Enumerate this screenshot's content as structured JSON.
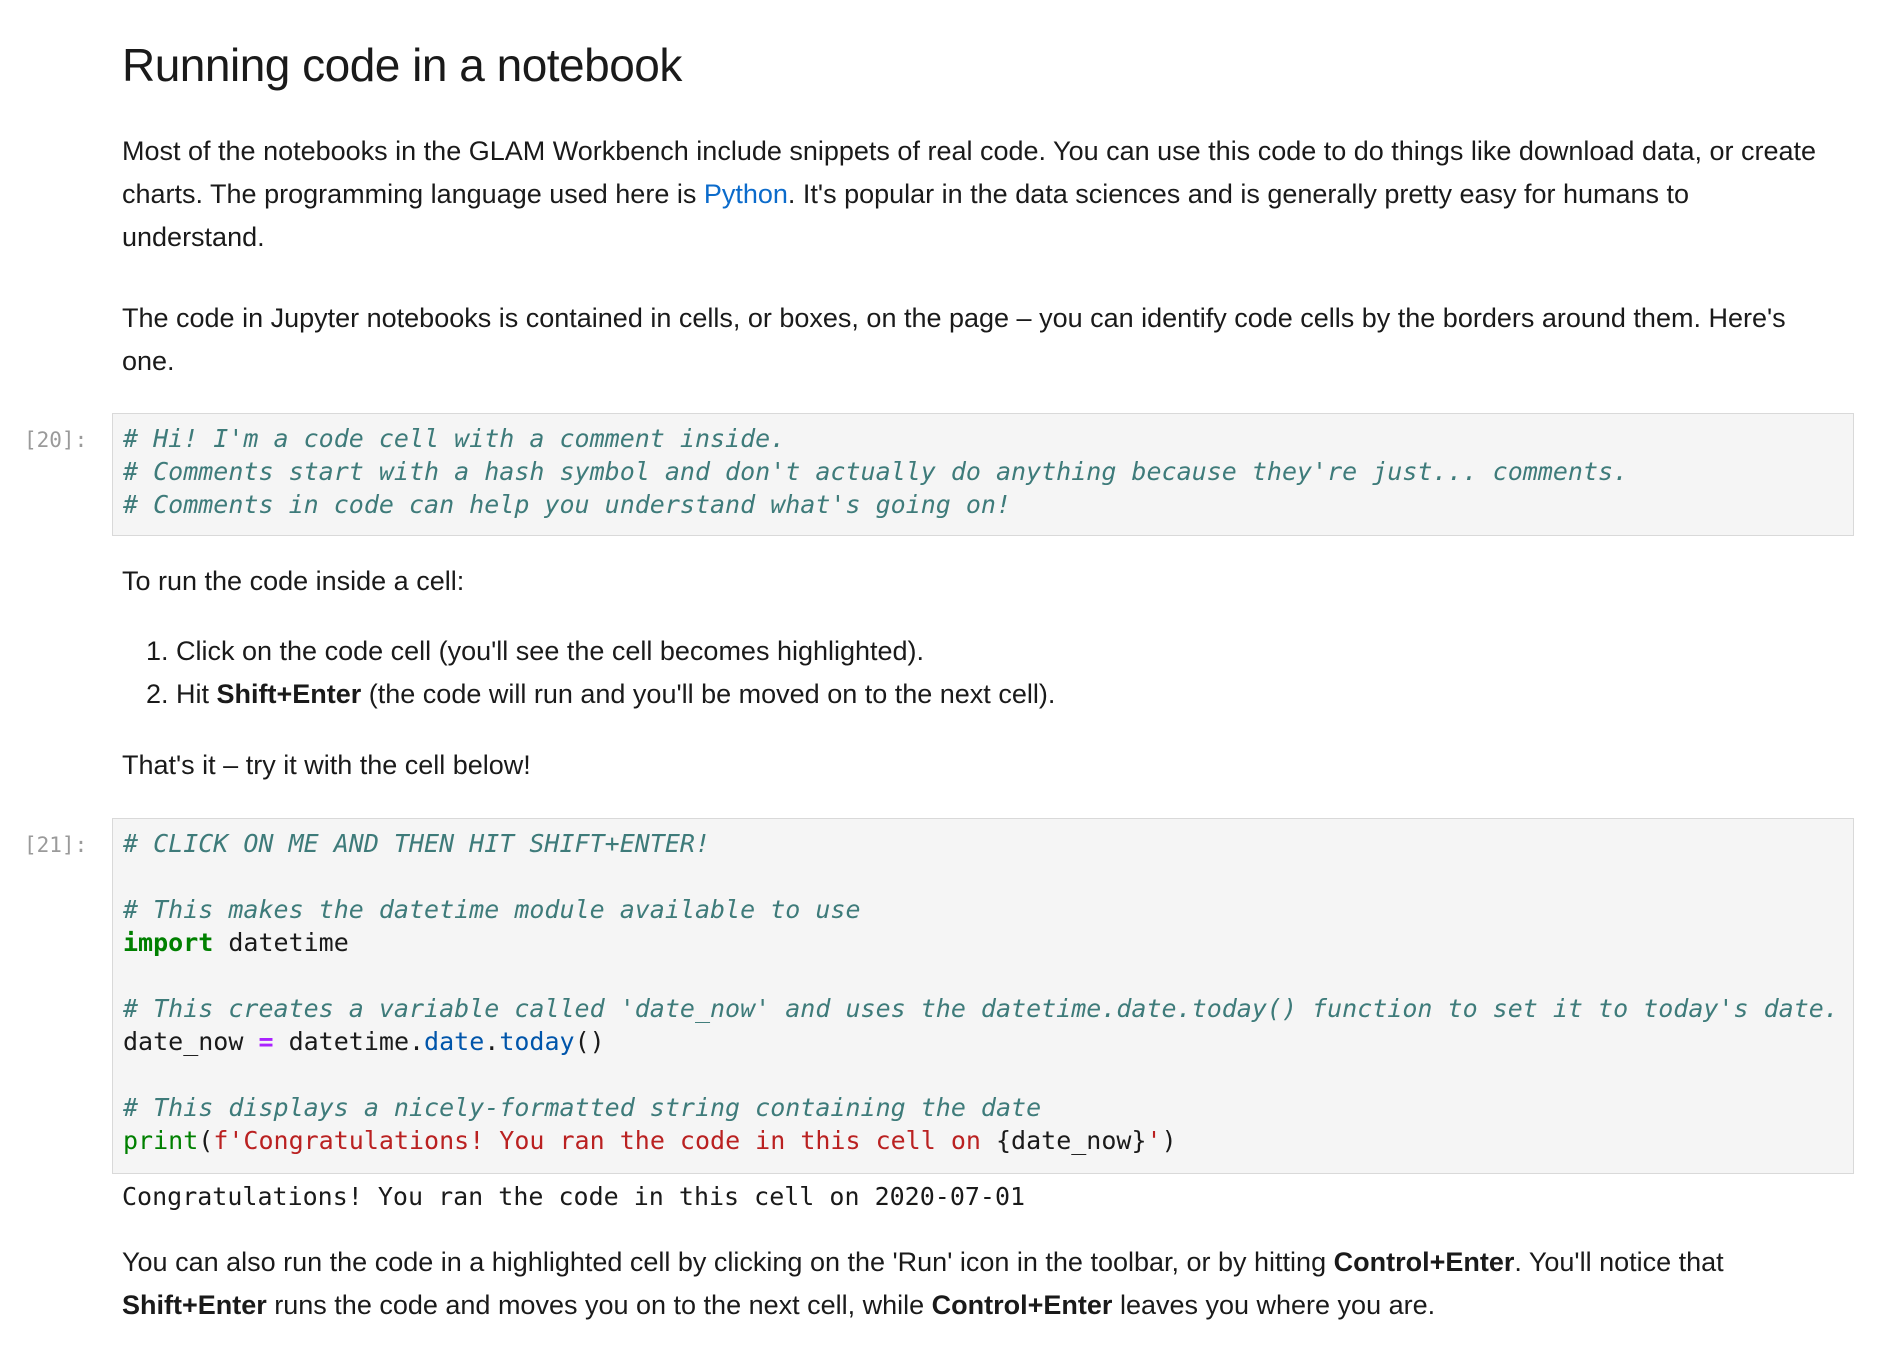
{
  "heading": "Running code in a notebook",
  "intro": {
    "part1": "Most of the notebooks in the GLAM Workbench include snippets of real code. You can use this code to do things like download data, or create charts. The programming language used here is ",
    "link": "Python",
    "part2": ". It's popular in the data sciences and is generally pretty easy for humans to understand."
  },
  "cells_paragraph": "The code in Jupyter notebooks is contained in cells, or boxes, on the page – you can identify code cells by the borders around them. Here's one.",
  "cell1": {
    "prompt": "[20]:",
    "line1": "# Hi! I'm a code cell with a comment inside.",
    "line2": "# Comments start with a hash symbol and don't actually do anything because they're just... comments.",
    "line3": "# Comments in code can help you understand what's going on!"
  },
  "run_intro": "To run the code inside a cell:",
  "steps": {
    "step1": "Click on the code cell (you'll see the cell becomes highlighted).",
    "step2_prefix": "Hit ",
    "step2_bold": "Shift+Enter",
    "step2_suffix": " (the code will run and you'll be moved on to the next cell)."
  },
  "try_it": "That's it – try it with the cell below!",
  "cell2": {
    "prompt": "[21]:",
    "comment1": "# CLICK ON ME AND THEN HIT SHIFT+ENTER!",
    "comment2": "# This makes the datetime module available to use",
    "import_kw": "import",
    "import_mod": " datetime",
    "comment3": "# This creates a variable called 'date_now' and uses the datetime.date.today() function to set it to today's date.",
    "assign_var": "date_now ",
    "assign_op": "=",
    "assign_obj": " datetime.",
    "assign_attr1": "date",
    "assign_dot": ".",
    "assign_attr2": "today",
    "assign_paren": "()",
    "comment4": "# This displays a nicely-formatted string containing the date",
    "print_fn": "print",
    "print_open": "(",
    "print_str": "f'Congratulations! You ran the code in this cell on ",
    "print_var": "{date_now}",
    "print_str_end": "'",
    "print_close": ")"
  },
  "output2": "Congratulations! You ran the code in this cell on 2020-07-01",
  "outro": {
    "part1": "You can also run the code in a highlighted cell by clicking on the 'Run' icon in the toolbar, or by hitting ",
    "bold1": "Control+Enter",
    "part2": ". You'll notice that ",
    "bold2": "Shift+Enter",
    "part3": " runs the code and moves you on to the next cell, while ",
    "bold3": "Control+Enter",
    "part4": " leaves you where you are."
  }
}
